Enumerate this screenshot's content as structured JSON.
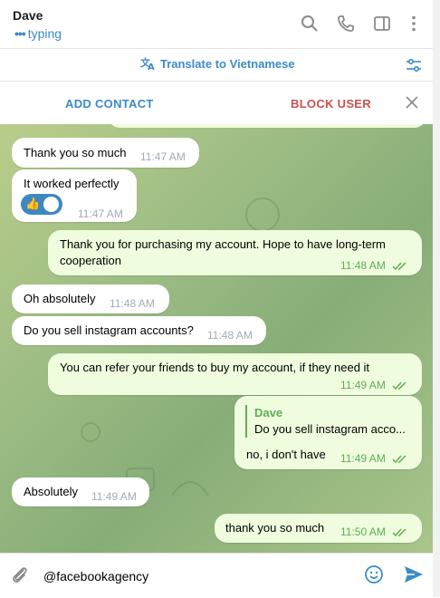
{
  "header": {
    "name": "Dave",
    "status": "typing",
    "icons": [
      "search-icon",
      "phone-icon",
      "sidebar-toggle-icon",
      "more-icon"
    ]
  },
  "translate_bar": {
    "label": "Translate to Vietnamese",
    "icons": [
      "translate-icon",
      "settings-sliders-icon"
    ]
  },
  "action_bar": {
    "add_contact": "ADD CONTACT",
    "block_user": "BLOCK USER"
  },
  "colors": {
    "accent": "#3a8bc9",
    "danger": "#d14e4e",
    "outgoing_bubble": "#effdde",
    "incoming_bubble": "#ffffff",
    "outgoing_time": "#5fad56"
  },
  "messages": [
    {
      "dir": "in",
      "text": "Thank you so much",
      "time": "11:47 AM"
    },
    {
      "dir": "in",
      "text": "It worked perfectly",
      "time": "11:47 AM",
      "reaction": "thumbs-up"
    },
    {
      "dir": "out",
      "text": "Thank you for purchasing my account. Hope to have long-term cooperation",
      "time": "11:48 AM"
    },
    {
      "dir": "in",
      "text": "Oh absolutely",
      "time": "11:48 AM"
    },
    {
      "dir": "in",
      "text": "Do you sell instagram accounts?",
      "time": "11:48 AM"
    },
    {
      "dir": "out",
      "text": "You can refer your friends to buy my account, if they need it",
      "time": "11:49 AM"
    },
    {
      "dir": "out",
      "reply_name": "Dave",
      "reply_text": "Do you sell instagram acco...",
      "text": "no, i don't have",
      "time": "11:49 AM"
    },
    {
      "dir": "in",
      "text": "Absolutely",
      "time": "11:49 AM"
    },
    {
      "dir": "out",
      "text": "thank you so much",
      "time": "11:50 AM"
    }
  ],
  "composer": {
    "value": "@facebookagency",
    "icons": [
      "attach-icon",
      "emoji-icon",
      "send-icon"
    ]
  }
}
